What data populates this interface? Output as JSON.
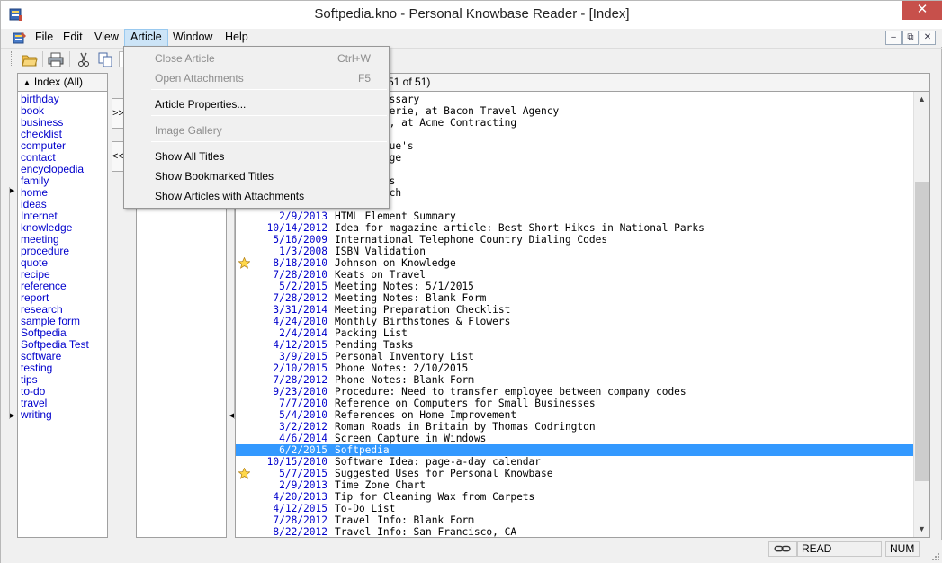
{
  "window": {
    "title": "Softpedia.kno - Personal Knowbase Reader - [Index]",
    "close_glyph": "✕"
  },
  "menubar": {
    "items": [
      "File",
      "Edit",
      "View",
      "Article",
      "Window",
      "Help"
    ],
    "active": "Article",
    "mdi_buttons": [
      "–",
      "⧉",
      "✕"
    ]
  },
  "toolbar": {
    "icons": [
      "open-folder-icon",
      "print-icon",
      "cut-icon",
      "copy-icon"
    ]
  },
  "article_menu": {
    "items": [
      {
        "label": "Close Article",
        "shortcut": "Ctrl+W",
        "enabled": false
      },
      {
        "label": "Open Attachments",
        "shortcut": "F5",
        "enabled": false
      },
      {
        "label": "Article Properties...",
        "shortcut": "",
        "enabled": true
      },
      {
        "label": "Image Gallery",
        "shortcut": "",
        "enabled": false
      },
      {
        "label": "Show All Titles",
        "shortcut": "",
        "enabled": true
      },
      {
        "label": "Show Bookmarked Titles",
        "shortcut": "",
        "enabled": true
      },
      {
        "label": "Show Articles with Attachments",
        "shortcut": "",
        "enabled": true
      }
    ]
  },
  "index_panel": {
    "header": "Index (All)",
    "keywords": [
      "birthday",
      "book",
      "business",
      "checklist",
      "computer",
      "contact",
      "encyclopedia",
      "family",
      "home",
      "ideas",
      "Internet",
      "knowledge",
      "meeting",
      "procedure",
      "quote",
      "recipe",
      "reference",
      "report",
      "research",
      "sample form",
      "Softpedia",
      "Softpedia Test",
      "software",
      "testing",
      "tips",
      "to-do",
      "travel",
      "writing"
    ]
  },
  "middle_buttons": [
    ">>",
    "<<"
  ],
  "titles_panel": {
    "header_count": "51 of 51)",
    "rows": [
      {
        "date": "",
        "title": "Terms Glossary",
        "star": false
      },
      {
        "date": "",
        "title": "etty, Valerie, at Bacon Travel Agency",
        "star": false
      },
      {
        "date": "",
        "title": "mith, Joe, at Acme Contracting",
        "star": false
      },
      {
        "date": "",
        "title": "g Tips",
        "star": false
      },
      {
        "date": "",
        "title": "to Aunt Sue's",
        "star": false
      },
      {
        "date": "",
        "title": "n Knowledge",
        "star": false
      },
      {
        "date": "",
        "title": "hday List",
        "star": false
      },
      {
        "date": "",
        "title": "t Contents",
        "star": false
      },
      {
        "date": "",
        "title": "on Research",
        "star": false
      },
      {
        "date": "",
        "title": "",
        "star": false
      },
      {
        "date": "2/9/2013",
        "title": "HTML Element Summary",
        "star": false
      },
      {
        "date": "10/14/2012",
        "title": "Idea for magazine article: Best Short Hikes in National Parks",
        "star": false
      },
      {
        "date": "5/16/2009",
        "title": "International Telephone Country Dialing Codes",
        "star": false
      },
      {
        "date": "1/3/2008",
        "title": "ISBN Validation",
        "star": false
      },
      {
        "date": "8/18/2010",
        "title": "Johnson on Knowledge",
        "star": true
      },
      {
        "date": "7/28/2010",
        "title": "Keats on Travel",
        "star": false
      },
      {
        "date": "5/2/2015",
        "title": "Meeting Notes: 5/1/2015",
        "star": false
      },
      {
        "date": "7/28/2012",
        "title": "Meeting Notes: Blank Form",
        "star": false
      },
      {
        "date": "3/31/2014",
        "title": "Meeting Preparation Checklist",
        "star": false
      },
      {
        "date": "4/24/2010",
        "title": "Monthly Birthstones & Flowers",
        "star": false
      },
      {
        "date": "2/4/2014",
        "title": "Packing List",
        "star": false
      },
      {
        "date": "4/12/2015",
        "title": "Pending Tasks",
        "star": false
      },
      {
        "date": "3/9/2015",
        "title": "Personal Inventory List",
        "star": false
      },
      {
        "date": "2/10/2015",
        "title": "Phone Notes: 2/10/2015",
        "star": false
      },
      {
        "date": "7/28/2012",
        "title": "Phone Notes: Blank Form",
        "star": false
      },
      {
        "date": "9/23/2010",
        "title": "Procedure: Need to transfer employee between company codes",
        "star": false
      },
      {
        "date": "7/7/2010",
        "title": "Reference on Computers for Small Businesses",
        "star": false
      },
      {
        "date": "5/4/2010",
        "title": "References on Home Improvement",
        "star": false
      },
      {
        "date": "3/2/2012",
        "title": "Roman Roads in Britain by Thomas Codrington",
        "star": false
      },
      {
        "date": "4/6/2014",
        "title": "Screen Capture in Windows",
        "star": false
      },
      {
        "date": "6/2/2015",
        "title": "Softpedia",
        "star": false,
        "selected": true
      },
      {
        "date": "10/15/2010",
        "title": "Software Idea: page-a-day calendar",
        "star": false
      },
      {
        "date": "5/7/2015",
        "title": "Suggested Uses for Personal Knowbase",
        "star": true
      },
      {
        "date": "2/9/2013",
        "title": "Time Zone Chart",
        "star": false
      },
      {
        "date": "4/20/2013",
        "title": "Tip for Cleaning Wax from Carpets",
        "star": false
      },
      {
        "date": "4/12/2015",
        "title": "To-Do List",
        "star": false
      },
      {
        "date": "7/28/2012",
        "title": "Travel Info: Blank Form",
        "star": false
      },
      {
        "date": "8/22/2012",
        "title": "Travel Info: San Francisco, CA",
        "star": false
      }
    ]
  },
  "statusbar": {
    "mode": "READ",
    "num": "NUM"
  },
  "colors": {
    "selection": "#3399ff",
    "link": "#0000cc",
    "close": "#c7504b",
    "menu_highlight": "#cce4f7"
  }
}
